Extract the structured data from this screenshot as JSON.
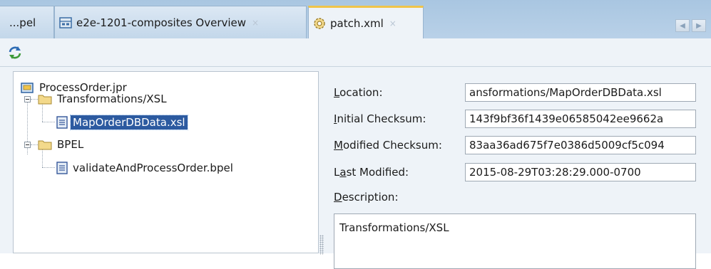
{
  "tabs": [
    {
      "label": "...pel",
      "icon": "none",
      "active": false
    },
    {
      "label": "e2e-1201-composites Overview",
      "icon": "composite-overview-icon",
      "active": false
    },
    {
      "label": "patch.xml",
      "icon": "patch-gear-icon",
      "active": true
    }
  ],
  "tab_close_glyph": "×",
  "nav": {
    "prev": "◀",
    "next": "▶"
  },
  "toolbar": {
    "refresh_icon": "refresh-icon"
  },
  "tree": {
    "root": "ProcessOrder.jpr",
    "items": [
      {
        "label": "Transformations/XSL",
        "type": "folder"
      },
      {
        "label": "MapOrderDBData.xsl",
        "type": "file",
        "selected": true
      },
      {
        "label": "BPEL",
        "type": "folder"
      },
      {
        "label": "validateAndProcessOrder.bpel",
        "type": "file"
      }
    ]
  },
  "form": {
    "location": {
      "mnemonic": "L",
      "rest": "ocation:",
      "value": "ansformations/MapOrderDBData.xsl"
    },
    "initial_checksum": {
      "mnemonic": "I",
      "rest": "nitial Checksum:",
      "value": "143f9bf36f1439e06585042ee9662a"
    },
    "modified_checksum": {
      "mnemonic": "M",
      "rest": "odified Checksum:",
      "value": "83aa36ad675f7e0386d5009cf5c094"
    },
    "last_modified": {
      "pre": "L",
      "mnemonic": "a",
      "rest": "st Modified:",
      "value": "2015-08-29T03:28:29.000-0700"
    },
    "description": {
      "mnemonic": "D",
      "rest": "escription:",
      "value": "Transformations/XSL"
    }
  },
  "colors": {
    "selection": "#2c5aa0",
    "active_tab_accent": "#f0c44a",
    "tabstrip": "#b1cce6"
  }
}
